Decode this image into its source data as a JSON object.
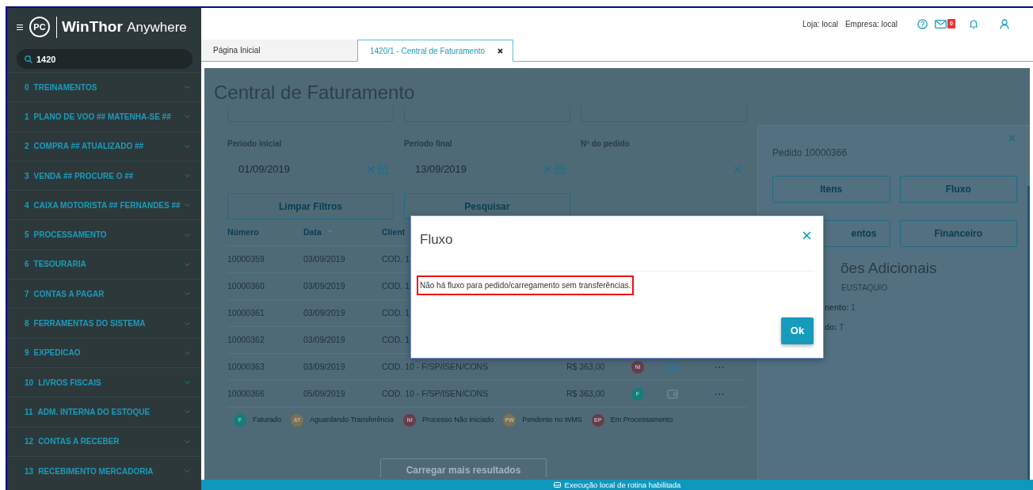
{
  "sidebar": {
    "logo_text": "PC",
    "brand": "WinThor",
    "brand_suffix": "Anywhere",
    "search": {
      "value": "1420"
    },
    "items": [
      {
        "number": "0",
        "label": "TREINAMENTOS"
      },
      {
        "number": "1",
        "label": "PLANO DE VOO ## MATENHA-SE ##"
      },
      {
        "number": "2",
        "label": "COMPRA ## ATUALIZADO ##"
      },
      {
        "number": "3",
        "label": "VENDA ## PROCURE O ##"
      },
      {
        "number": "4",
        "label": "CAIXA MOTORISTA ## FERNANDES ##"
      },
      {
        "number": "5",
        "label": "PROCESSAMENTO"
      },
      {
        "number": "6",
        "label": "TESOURARIA"
      },
      {
        "number": "7",
        "label": "CONTAS A PAGAR"
      },
      {
        "number": "8",
        "label": "FERRAMENTAS DO SISTEMA"
      },
      {
        "number": "9",
        "label": "EXPEDICAO"
      },
      {
        "number": "10",
        "label": "LIVROS FISCAIS"
      },
      {
        "number": "11",
        "label": "ADM. INTERNA DO ESTOQUE"
      },
      {
        "number": "12",
        "label": "CONTAS A RECEBER"
      },
      {
        "number": "13",
        "label": "RECEBIMENTO MERCADORIA"
      }
    ]
  },
  "header": {
    "store": "Loja: local",
    "company": "Empresa: local",
    "mail_count": "0"
  },
  "tabs": [
    {
      "label": "Página Inicial",
      "selected": false,
      "closable": false
    },
    {
      "label": "1420/1 - Central de Faturamento",
      "selected": true,
      "closable": true
    }
  ],
  "page": {
    "title": "Central de Faturamento",
    "filters": [
      {
        "label": "Período inicial",
        "value": "01/09/2019",
        "calendar": true
      },
      {
        "label": "Período final",
        "value": "13/09/2019",
        "calendar": true
      },
      {
        "label": "Nº do pedido",
        "calendar": false
      }
    ],
    "buttons": [
      "Limpar Filtros",
      "Pesquisar"
    ],
    "table": {
      "columns": [
        "Número",
        "Data",
        "Client"
      ],
      "rows": [
        {
          "number": "10000359",
          "date": "03/09/2019",
          "client": "COD. 1"
        },
        {
          "number": "10000360",
          "date": "03/09/2019",
          "client": "COD. 1"
        },
        {
          "number": "10000361",
          "date": "03/09/2019",
          "client": "COD. 1"
        },
        {
          "number": "10000362",
          "date": "03/09/2019",
          "client": "COD. 1"
        },
        {
          "number": "10000363",
          "date": "03/09/2019",
          "client": "COD. 10 - F/SP/ISEN/CONS",
          "value": "R$ 363,00",
          "status": "NI",
          "color": "#6a3a4c",
          "invoice_enabled": true,
          "menu": "···"
        },
        {
          "number": "10000366",
          "date": "05/09/2019",
          "client": "COD. 10 - F/SP/ISEN/CONS",
          "value": "R$ 363,00",
          "status": "F",
          "color": "#117f7c",
          "invoice_enabled": false,
          "menu": "···"
        }
      ]
    },
    "legend": [
      {
        "code": "F",
        "label": "Faturado",
        "color": "#117f7c"
      },
      {
        "code": "AT",
        "label": "Aguardando Transferência",
        "color": "#7e7150"
      },
      {
        "code": "NI",
        "label": "Processo Não Iniciado",
        "color": "#6a3a4c"
      },
      {
        "code": "PW",
        "label": "Pendente no WMS",
        "color": "#7e7150"
      },
      {
        "code": "EP",
        "label": "Em Processamento",
        "color": "#6a3a4c"
      }
    ],
    "load_more": "Carregar mais resultados"
  },
  "detail": {
    "title": "Pedido 10000366",
    "buttons": [
      "Itens",
      "Fluxo",
      "entos",
      "Financeiro"
    ],
    "section_title": "ões Adicionais",
    "lines": [
      {
        "value": "EUSTAQUIO"
      },
      {
        "label": "nento:",
        "value": "1"
      },
      {
        "label": "do:",
        "value": "T"
      }
    ]
  },
  "modal": {
    "title": "Fluxo",
    "message": "Não há fluxo para pedido/carregamento sem transferências.",
    "ok": "Ok"
  },
  "status_bar": "Execução local de rotina habilitada"
}
